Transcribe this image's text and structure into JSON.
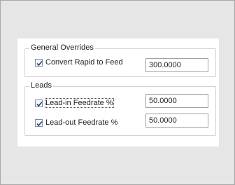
{
  "general_overrides": {
    "legend": "General Overrides",
    "convert_rapid": {
      "label": "Convert Rapid to Feed",
      "checked": true,
      "value": "300.0000"
    }
  },
  "leads": {
    "legend": "Leads",
    "lead_in": {
      "label": "Lead-in Feedrate %",
      "checked": true,
      "value": "50.0000"
    },
    "lead_out": {
      "label": "Lead-out Feedrate %",
      "checked": true,
      "value": "50.0000"
    }
  }
}
